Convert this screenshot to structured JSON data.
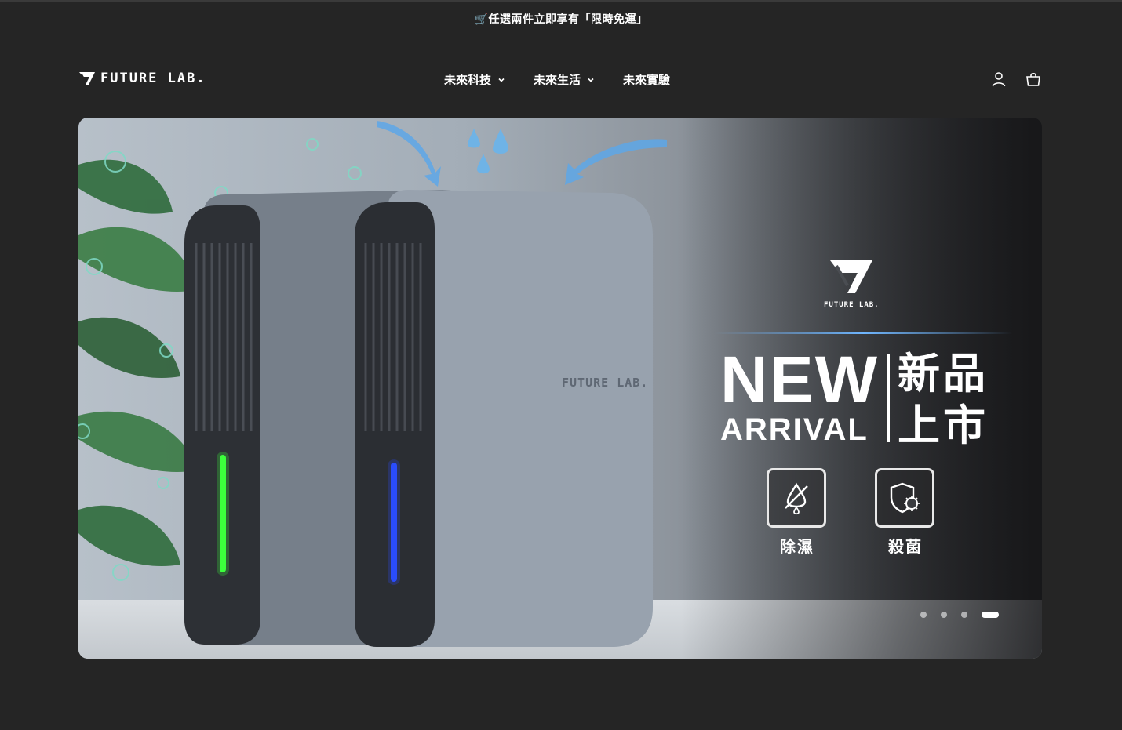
{
  "announcement": "🛒任選兩件立即享有「限時免運」",
  "brand": {
    "name": "FUTURE LAB.",
    "small_name": "FUTURE LAB."
  },
  "nav": [
    {
      "label": "未來科技",
      "has_dropdown": true
    },
    {
      "label": "未來生活",
      "has_dropdown": true
    },
    {
      "label": "未來實驗",
      "has_dropdown": false
    }
  ],
  "header_icons": [
    "user-icon",
    "cart-icon"
  ],
  "hero": {
    "headline_en_1": "NEW",
    "headline_en_2": "ARRIVAL",
    "headline_zh_1": "新品",
    "headline_zh_2": "上市",
    "product_print": "FUTURE LAB.",
    "features": [
      {
        "label": "除濕",
        "icon": "no-droplet-icon"
      },
      {
        "label": "殺菌",
        "icon": "shield-virus-icon"
      }
    ],
    "slides_total": 4,
    "active_slide": 4
  },
  "colors": {
    "background": "#252525",
    "accent_glow": "#6fb6ff",
    "led_green": "#3cff3c",
    "led_blue": "#2a4dff"
  }
}
